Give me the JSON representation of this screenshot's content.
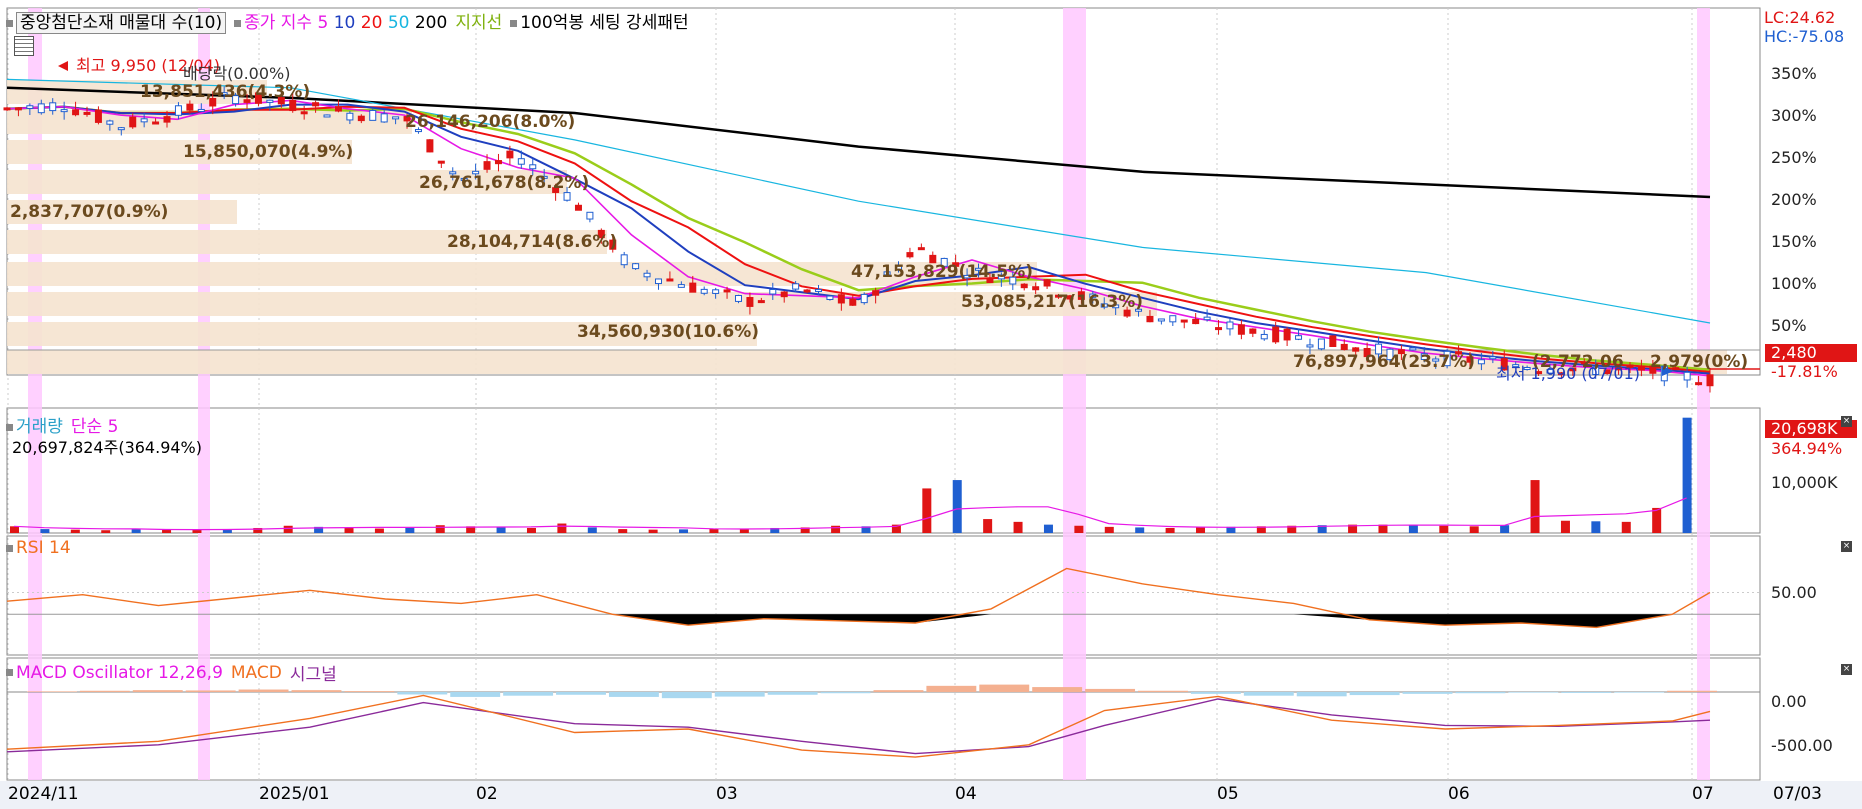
{
  "legend": {
    "stock_name": "중앙첨단소재 매물대 수(10)",
    "ma_prefix": "종가 지수",
    "ma_periods": [
      "5",
      "10",
      "20",
      "50",
      "200"
    ],
    "ma_colors": [
      "#e619e6",
      "#1f3fbf",
      "#ee1111",
      "#18b6e0",
      "#000000"
    ],
    "support_label": "지지선",
    "pattern_label": "100억봉 세팅 강세패턴"
  },
  "price_panel": {
    "lc_label": "LC:24.62",
    "hc_label": "HC:-75.08",
    "current_price_tag": "2,480",
    "change_pct": "-17.81%",
    "high_label": "최고 9,950 (12/04)",
    "low_label": "최저 1,990 (07/01)",
    "dividend_label": "배당락(0.00%)",
    "axis_ticks": [
      "350%",
      "300%",
      "250%",
      "200%",
      "150%",
      "100%",
      "50%"
    ],
    "volume_profile": [
      {
        "label": "13,851,436(4.3%)"
      },
      {
        "label": "26,146,206(8.0%)"
      },
      {
        "label": "15,850,070(4.9%)"
      },
      {
        "label": "26,761,678(8.2%)"
      },
      {
        "label": "2,837,707(0.9%)"
      },
      {
        "label": "28,104,714(8.6%)"
      },
      {
        "label": "47,153,829(14.5%)"
      },
      {
        "label": "53,085,217(16.3%)"
      },
      {
        "label": "34,560,930(10.6%)"
      },
      {
        "label": "76,897,964(23.7%)"
      },
      {
        "label": "(2,772,06"
      },
      {
        "label": "2,979(0%)"
      }
    ]
  },
  "volume_panel": {
    "title": "거래량",
    "ma_label": "단순 5",
    "summary": "20,697,824주(364.94%)",
    "tag_value": "20,698K",
    "tag_pct": "364.94%",
    "axis_tick": "10,000K"
  },
  "rsi_panel": {
    "title": "RSI 14",
    "axis_tick": "50.00"
  },
  "macd_panel": {
    "title": "MACD Oscillator 12,26,9",
    "macd_label": "MACD",
    "signal_label": "시그널",
    "axis_ticks": [
      "0.00",
      "-500.00"
    ]
  },
  "x_axis": {
    "labels": [
      "2024/11",
      "2025/01",
      "02",
      "03",
      "04",
      "05",
      "06",
      "07"
    ],
    "right_label": "07/03"
  },
  "colors": {
    "up": "#e01515",
    "down": "#1f5fd1",
    "profile": "#f5e3cf",
    "highlight": "#ffc8ff",
    "ma5": "#e619e6",
    "ma10": "#1f3fbf",
    "ma20": "#ee1111",
    "ma50": "#18b6e0",
    "ma200": "#000000",
    "support": "#9acd1a",
    "rsi": "#f07020",
    "macd": "#f07020",
    "signal": "#8a2a9a",
    "osc_pos": "#f4b090",
    "osc_neg": "#a9d8f0"
  },
  "chart_data": {
    "type": "candlestick",
    "description_axis": "daily candles with MA overlays, volume, RSI, MACD",
    "ma_curves_pct": {
      "ma200": [
        [
          0,
          330
        ],
        [
          150,
          318
        ],
        [
          300,
          300
        ],
        [
          450,
          260
        ],
        [
          600,
          230
        ],
        [
          750,
          215
        ],
        [
          900,
          200
        ]
      ],
      "ma50": [
        [
          0,
          340
        ],
        [
          150,
          330
        ],
        [
          300,
          268
        ],
        [
          450,
          195
        ],
        [
          600,
          140
        ],
        [
          750,
          110
        ],
        [
          900,
          50
        ]
      ]
    },
    "close_path": [
      [
        0,
        305
      ],
      [
        30,
        310
      ],
      [
        60,
        285
      ],
      [
        90,
        300
      ],
      [
        120,
        320
      ],
      [
        150,
        310
      ],
      [
        180,
        300
      ],
      [
        210,
        295
      ],
      [
        240,
        220
      ],
      [
        270,
        250
      ],
      [
        300,
        195
      ],
      [
        330,
        115
      ],
      [
        360,
        95
      ],
      [
        390,
        75
      ],
      [
        420,
        90
      ],
      [
        450,
        70
      ],
      [
        480,
        140
      ],
      [
        510,
        110
      ],
      [
        540,
        100
      ],
      [
        570,
        80
      ],
      [
        600,
        60
      ],
      [
        630,
        50
      ],
      [
        660,
        40
      ],
      [
        690,
        30
      ],
      [
        720,
        18
      ],
      [
        750,
        10
      ],
      [
        780,
        5
      ],
      [
        810,
        -2
      ],
      [
        840,
        -5
      ],
      [
        870,
        -8
      ],
      [
        900,
        -17.81
      ]
    ],
    "volume_k": [
      1200,
      700,
      600,
      500,
      650,
      700,
      600,
      650,
      900,
      1300,
      1100,
      900,
      800,
      950,
      1400,
      1200,
      1000,
      900,
      1700,
      1000,
      700,
      600,
      650,
      800,
      800,
      900,
      1000,
      1300,
      1200,
      1500,
      8000,
      9500,
      2500,
      2000,
      1500,
      1300,
      1100,
      1000,
      900,
      1000,
      1100,
      1200,
      1300,
      1400,
      1500,
      1500,
      1400,
      1300,
      1200,
      1400,
      9500,
      2200,
      2100,
      2000,
      4500,
      20698
    ],
    "rsi": [
      [
        0,
        42
      ],
      [
        40,
        48
      ],
      [
        80,
        38
      ],
      [
        120,
        45
      ],
      [
        160,
        52
      ],
      [
        200,
        44
      ],
      [
        240,
        40
      ],
      [
        280,
        48
      ],
      [
        320,
        30
      ],
      [
        360,
        20
      ],
      [
        400,
        26
      ],
      [
        440,
        24
      ],
      [
        480,
        22
      ],
      [
        520,
        35
      ],
      [
        560,
        72
      ],
      [
        600,
        58
      ],
      [
        640,
        48
      ],
      [
        680,
        40
      ],
      [
        720,
        25
      ],
      [
        760,
        20
      ],
      [
        800,
        22
      ],
      [
        840,
        18
      ],
      [
        880,
        30
      ],
      [
        900,
        50
      ]
    ],
    "macd": [
      [
        0,
        -650
      ],
      [
        80,
        -560
      ],
      [
        160,
        -300
      ],
      [
        220,
        -40
      ],
      [
        300,
        -460
      ],
      [
        360,
        -420
      ],
      [
        420,
        -660
      ],
      [
        480,
        -740
      ],
      [
        540,
        -600
      ],
      [
        580,
        -210
      ],
      [
        640,
        -50
      ],
      [
        700,
        -320
      ],
      [
        760,
        -420
      ],
      [
        820,
        -380
      ],
      [
        880,
        -330
      ],
      [
        900,
        -220
      ]
    ],
    "signal": [
      [
        0,
        -680
      ],
      [
        80,
        -600
      ],
      [
        160,
        -400
      ],
      [
        220,
        -120
      ],
      [
        300,
        -360
      ],
      [
        360,
        -400
      ],
      [
        420,
        -560
      ],
      [
        480,
        -700
      ],
      [
        540,
        -620
      ],
      [
        580,
        -380
      ],
      [
        640,
        -80
      ],
      [
        700,
        -260
      ],
      [
        760,
        -380
      ],
      [
        820,
        -390
      ],
      [
        880,
        -340
      ],
      [
        900,
        -320
      ]
    ],
    "osc": [
      20,
      40,
      60,
      50,
      80,
      60,
      30,
      -80,
      -160,
      -120,
      -90,
      -160,
      -200,
      -150,
      -90,
      -40,
      60,
      200,
      240,
      160,
      100,
      40,
      -60,
      -120,
      -140,
      -100,
      -60,
      -40,
      -20,
      -30,
      -20,
      40
    ]
  }
}
